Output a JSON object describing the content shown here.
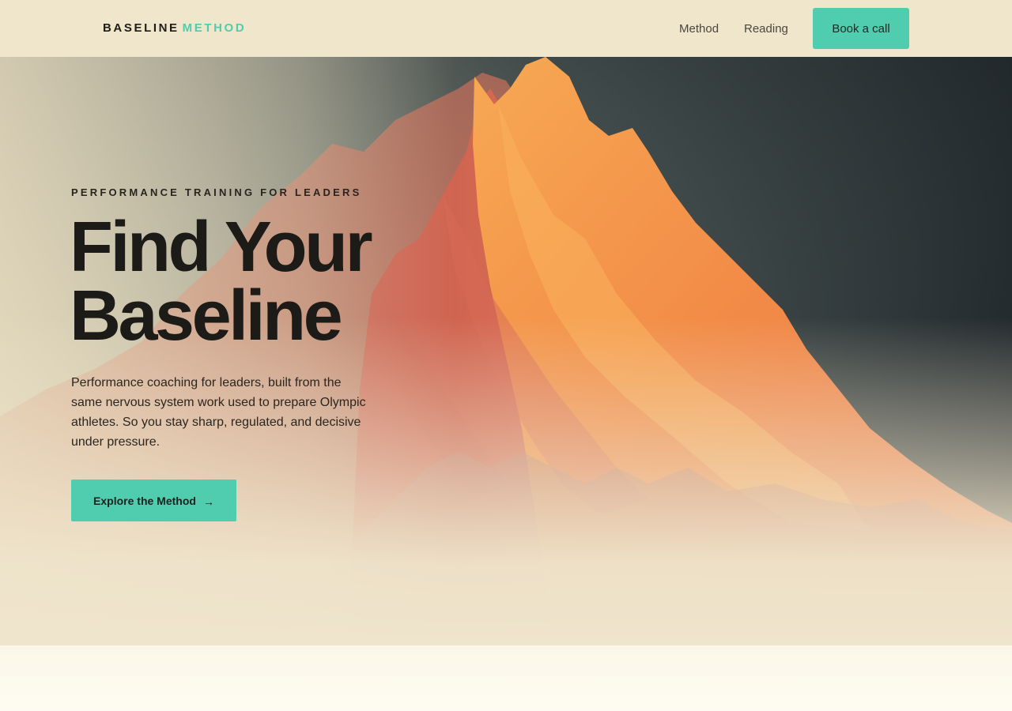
{
  "header": {
    "logo": {
      "primary": "BASELINE",
      "accent": "METHOD"
    },
    "nav": [
      {
        "label": "Method"
      },
      {
        "label": "Reading"
      }
    ],
    "cta_label": "Book a call"
  },
  "hero": {
    "eyebrow": "PERFORMANCE TRAINING FOR LEADERS",
    "headline": [
      "Find Your",
      "Baseline"
    ],
    "lede": "Performance coaching for leaders, built from the same nervous system work used to prepare Olympic athletes. So you stay sharp, regulated, and decisive under pressure.",
    "cta": {
      "label": "Explore the Method",
      "icon": "arrow-right-icon",
      "glyph": "→"
    },
    "background_image": "mountain-illustration"
  },
  "colors": {
    "accent": "#4fcdae",
    "header_bg": "#f0e6cb",
    "text_dark": "#1c1b17",
    "sky_dark": "#263033",
    "mountain_orange": "#f39a4c",
    "mountain_coral": "#df7560"
  }
}
